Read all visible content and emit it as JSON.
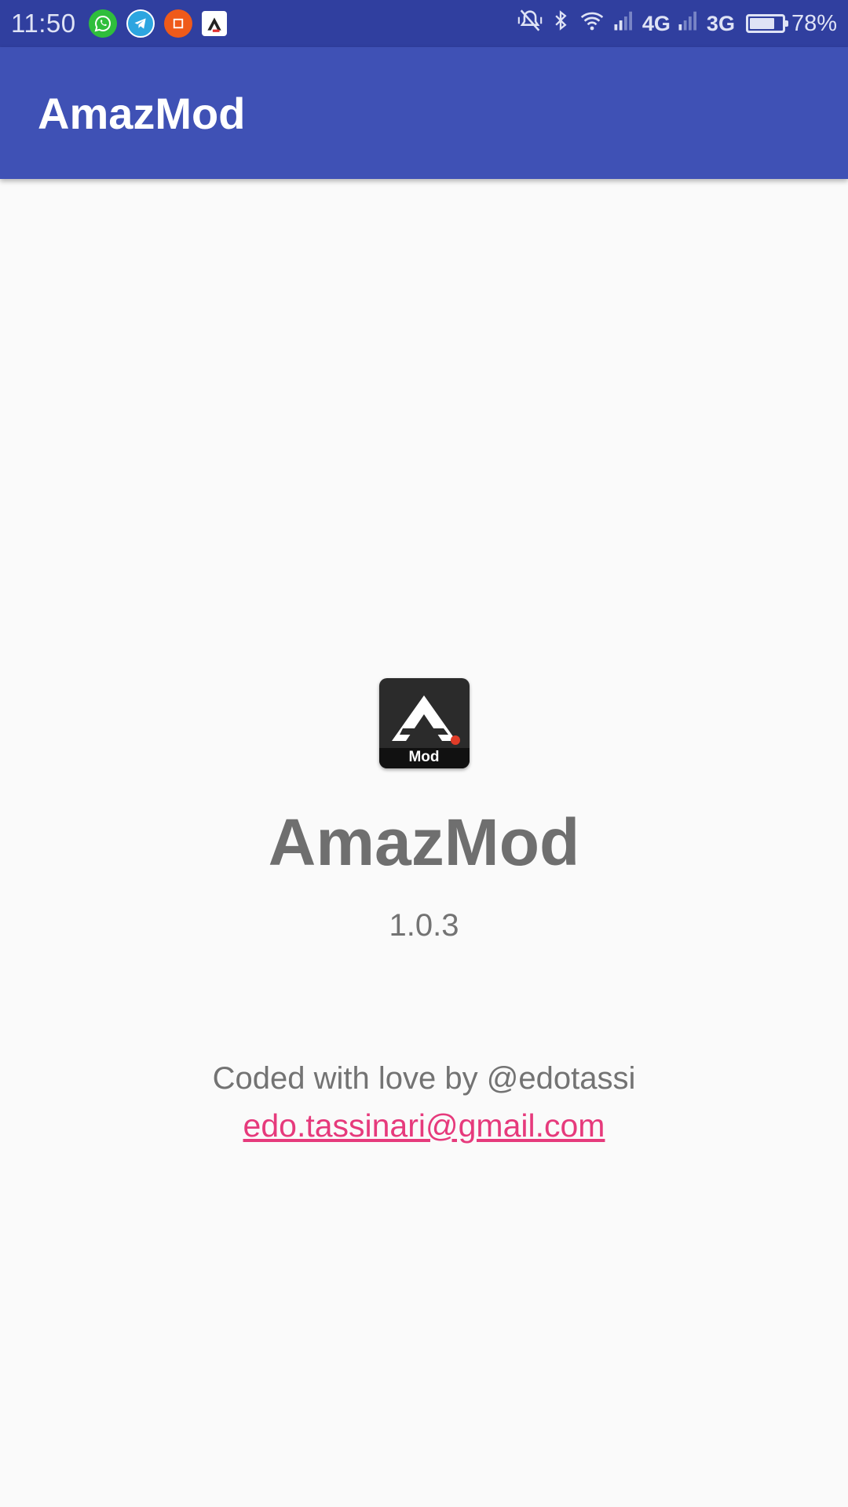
{
  "status_bar": {
    "time": "11:50",
    "notifications": [
      {
        "icon": "whatsapp-icon",
        "color": "#25d366"
      },
      {
        "icon": "telegram-icon",
        "color": "#2ca5e0"
      },
      {
        "icon": "crop-app-icon",
        "color": "#ef5a1a"
      },
      {
        "icon": "amazmod-notification-icon",
        "color": "#ffffff"
      }
    ],
    "network_1": "4G",
    "network_2": "3G",
    "battery_percent_label": "78%",
    "battery_level": 0.78
  },
  "app_bar": {
    "title": "AmazMod",
    "color": "#3f51b5"
  },
  "about": {
    "app_icon_label": "Mod",
    "app_name": "AmazMod",
    "version": "1.0.3",
    "credit": "Coded with love by @edotassi",
    "email": "edo.tassinari@gmail.com",
    "email_color": "#e63a7c"
  }
}
